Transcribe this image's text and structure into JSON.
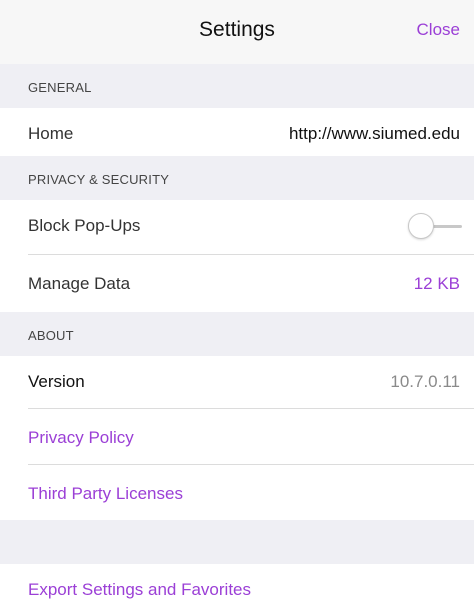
{
  "header": {
    "title": "Settings",
    "close_label": "Close"
  },
  "sections": {
    "general": {
      "title": "GENERAL",
      "home_label": "Home",
      "home_value": "http://www.siumed.edu"
    },
    "privacy": {
      "title": "PRIVACY & SECURITY",
      "block_popups_label": "Block Pop-Ups",
      "block_popups_enabled": false,
      "manage_data_label": "Manage Data",
      "manage_data_value": "12 KB"
    },
    "about": {
      "title": "ABOUT",
      "version_label": "Version",
      "version_value": "10.7.0.11",
      "privacy_policy_label": "Privacy Policy",
      "third_party_label": "Third Party Licenses"
    }
  },
  "footer": {
    "export_label": "Export Settings and Favorites"
  },
  "colors": {
    "accent": "#9b3fd6",
    "header_bg": "#efeff4"
  }
}
